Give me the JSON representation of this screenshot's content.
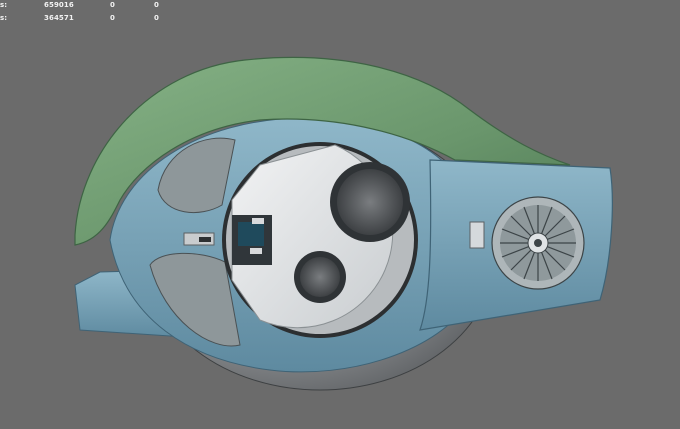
{
  "hud": {
    "rows": [
      {
        "label": "s:",
        "values": [
          "659016",
          "0",
          "0"
        ]
      },
      {
        "label": "s:",
        "values": [
          "364571",
          "0",
          "0"
        ]
      }
    ]
  },
  "colors": {
    "viewport_bg": "#6b6b6b",
    "shell_green": "#6e9a72",
    "body_blue": "#7aa3b6",
    "plate_white": "#e2e5e7",
    "metal_gray": "#b9bcbf"
  },
  "icons": [
    "fan-icon"
  ]
}
